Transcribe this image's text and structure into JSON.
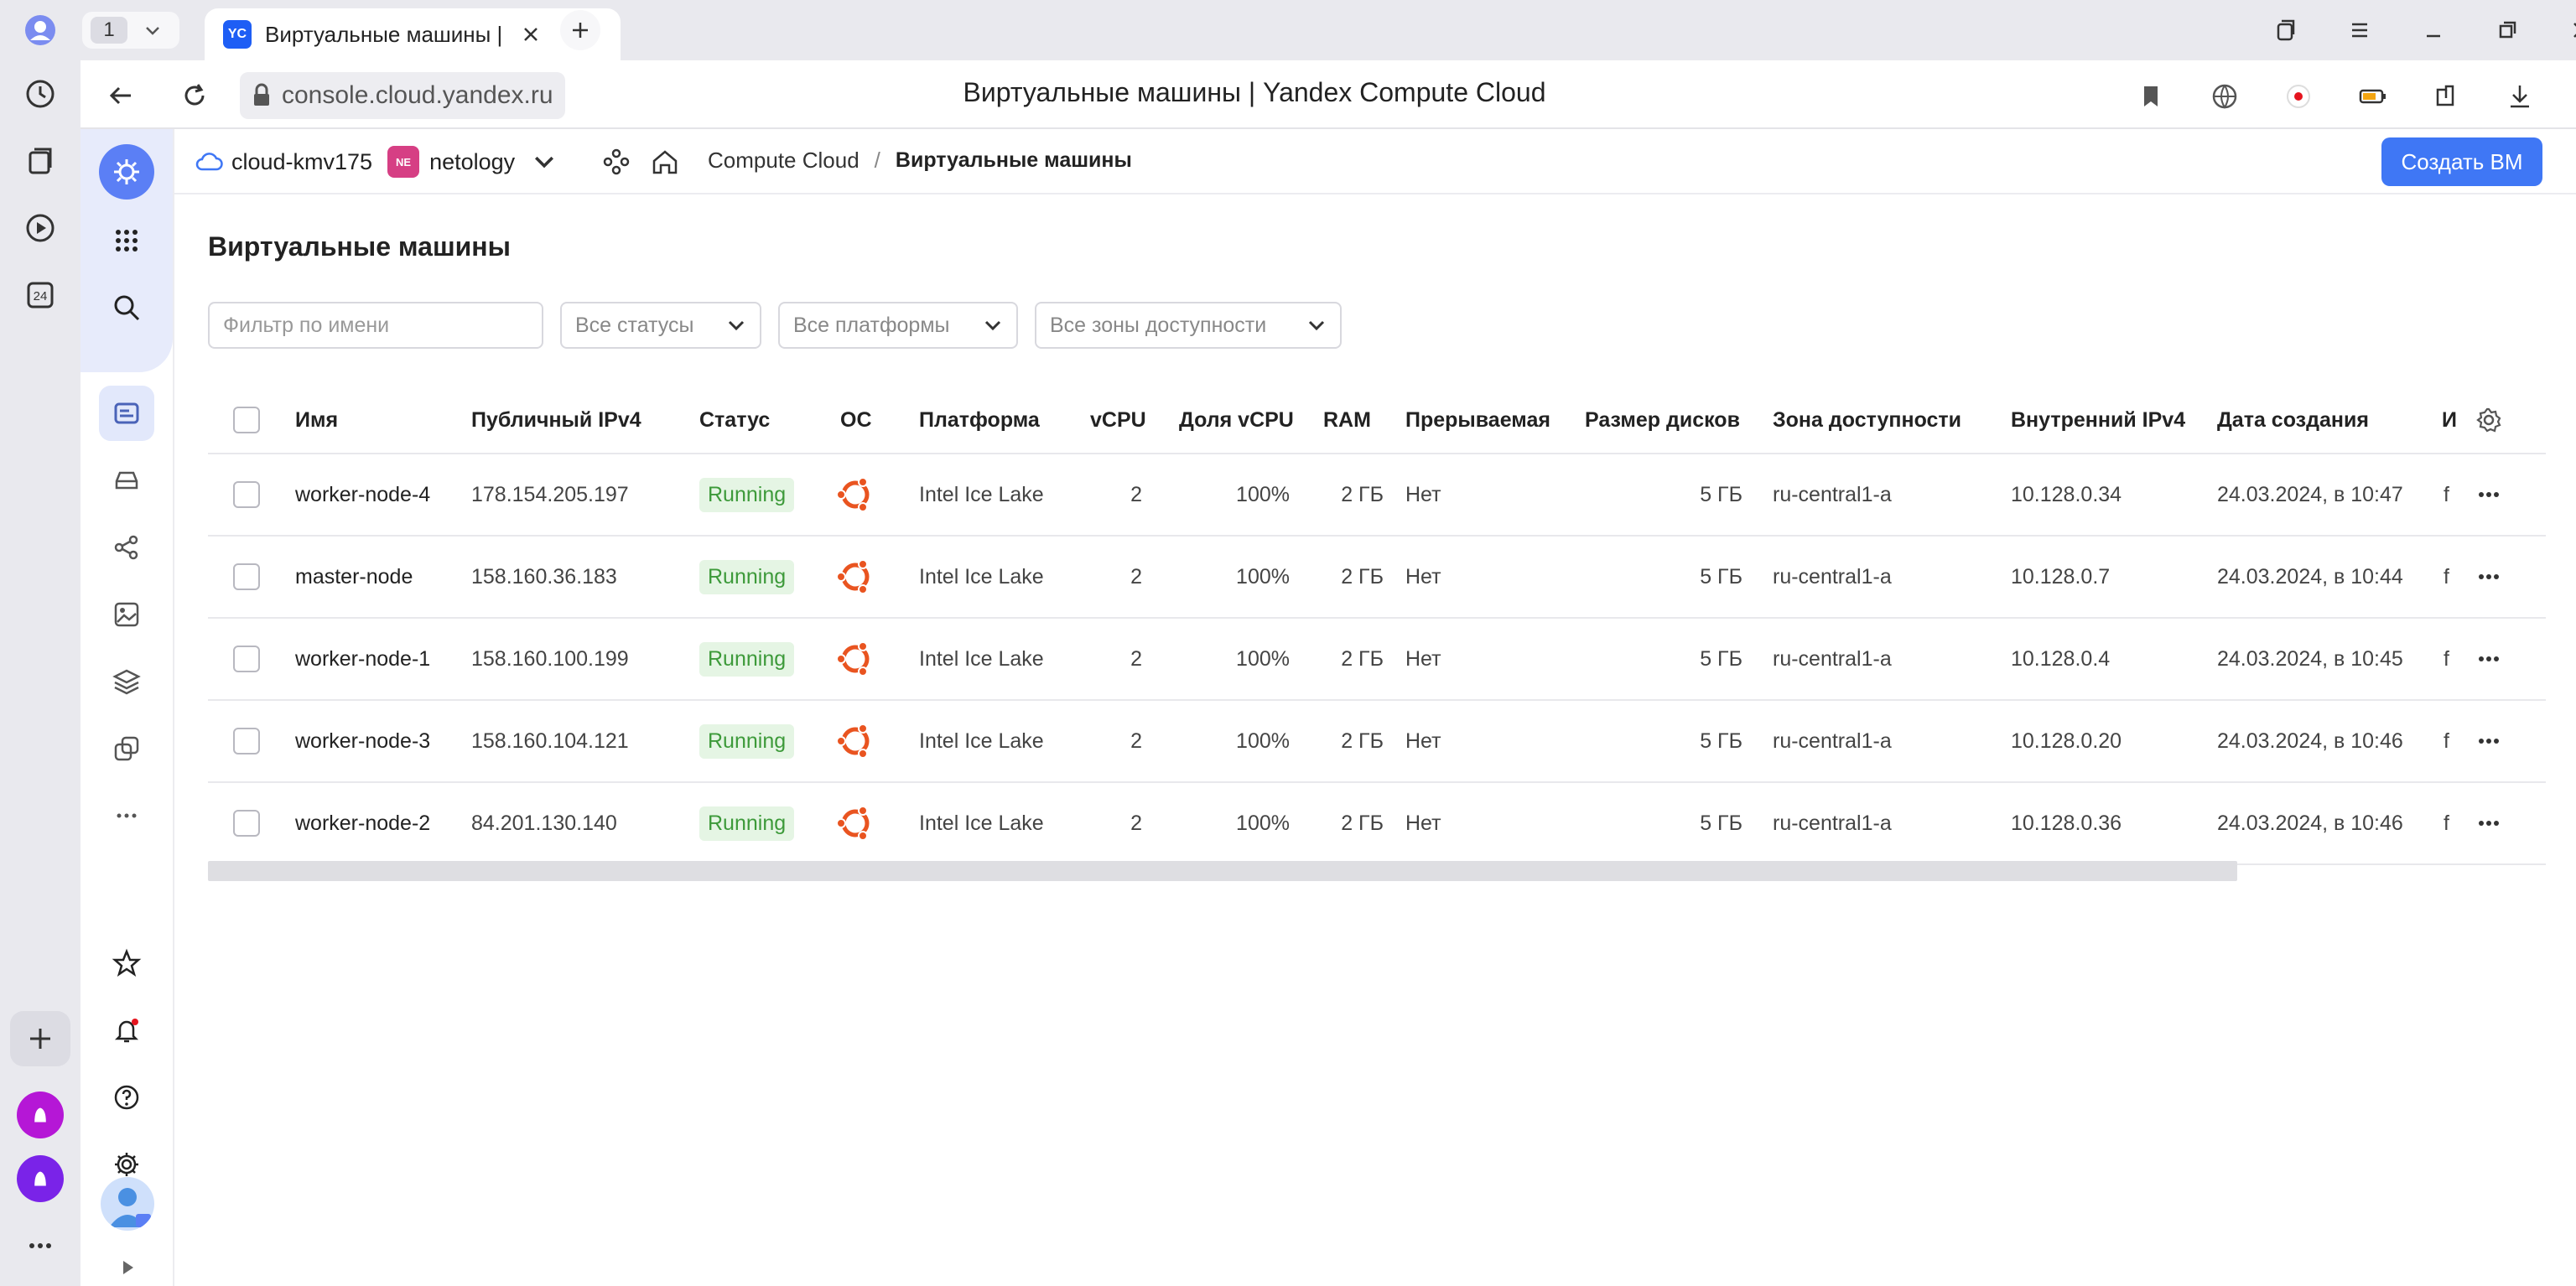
{
  "browser": {
    "tab_count": "1",
    "tab_title": "Виртуальные машины | Yandex Compute Cloud",
    "url": "console.cloud.yandex.ru",
    "page_title": "Виртуальные машины | Yandex Compute Cloud",
    "favicon_text": "YC",
    "rail_badge": "24"
  },
  "console": {
    "cloud_name": "cloud-kmv175",
    "folder_badge": "NE",
    "folder_name": "netology",
    "breadcrumb": {
      "service": "Compute Cloud",
      "separator": "/",
      "current": "Виртуальные машины"
    },
    "create_button": "Создать ВМ"
  },
  "main": {
    "title": "Виртуальные машины",
    "filters": {
      "name_placeholder": "Фильтр по имени",
      "status": "Все статусы",
      "platform": "Все платформы",
      "zone": "Все зоны доступности"
    }
  },
  "table": {
    "columns": [
      "Имя",
      "Публичный IPv4",
      "Статус",
      "ОС",
      "Платформа",
      "vCPU",
      "Доля vCPU",
      "RAM",
      "Прерываемая",
      "Размер дисков",
      "Зона доступности",
      "Внутренний IPv4",
      "Дата создания",
      "И"
    ],
    "rows": [
      {
        "name": "worker-node-4",
        "ip": "178.154.205.197",
        "status": "Running",
        "platform": "Intel Ice Lake",
        "vcpu": "2",
        "share": "100%",
        "ram": "2 ГБ",
        "preempt": "Нет",
        "disk": "5 ГБ",
        "zone": "ru-central1-a",
        "internal": "10.128.0.34",
        "created": "24.03.2024, в 10:47",
        "trunc": "f"
      },
      {
        "name": "master-node",
        "ip": "158.160.36.183",
        "status": "Running",
        "platform": "Intel Ice Lake",
        "vcpu": "2",
        "share": "100%",
        "ram": "2 ГБ",
        "preempt": "Нет",
        "disk": "5 ГБ",
        "zone": "ru-central1-a",
        "internal": "10.128.0.7",
        "created": "24.03.2024, в 10:44",
        "trunc": "f"
      },
      {
        "name": "worker-node-1",
        "ip": "158.160.100.199",
        "status": "Running",
        "platform": "Intel Ice Lake",
        "vcpu": "2",
        "share": "100%",
        "ram": "2 ГБ",
        "preempt": "Нет",
        "disk": "5 ГБ",
        "zone": "ru-central1-a",
        "internal": "10.128.0.4",
        "created": "24.03.2024, в 10:45",
        "trunc": "f"
      },
      {
        "name": "worker-node-3",
        "ip": "158.160.104.121",
        "status": "Running",
        "platform": "Intel Ice Lake",
        "vcpu": "2",
        "share": "100%",
        "ram": "2 ГБ",
        "preempt": "Нет",
        "disk": "5 ГБ",
        "zone": "ru-central1-a",
        "internal": "10.128.0.20",
        "created": "24.03.2024, в 10:46",
        "trunc": "f"
      },
      {
        "name": "worker-node-2",
        "ip": "84.201.130.140",
        "status": "Running",
        "platform": "Intel Ice Lake",
        "vcpu": "2",
        "share": "100%",
        "ram": "2 ГБ",
        "preempt": "Нет",
        "disk": "5 ГБ",
        "zone": "ru-central1-a",
        "internal": "10.128.0.36",
        "created": "24.03.2024, в 10:46",
        "trunc": "f"
      }
    ]
  },
  "colors": {
    "accent": "#3f77f5",
    "status_running_bg": "#e5f5e4",
    "status_running_text": "#3d9a3a",
    "ubuntu": "#e95420",
    "folder_badge": "#d63f84"
  }
}
